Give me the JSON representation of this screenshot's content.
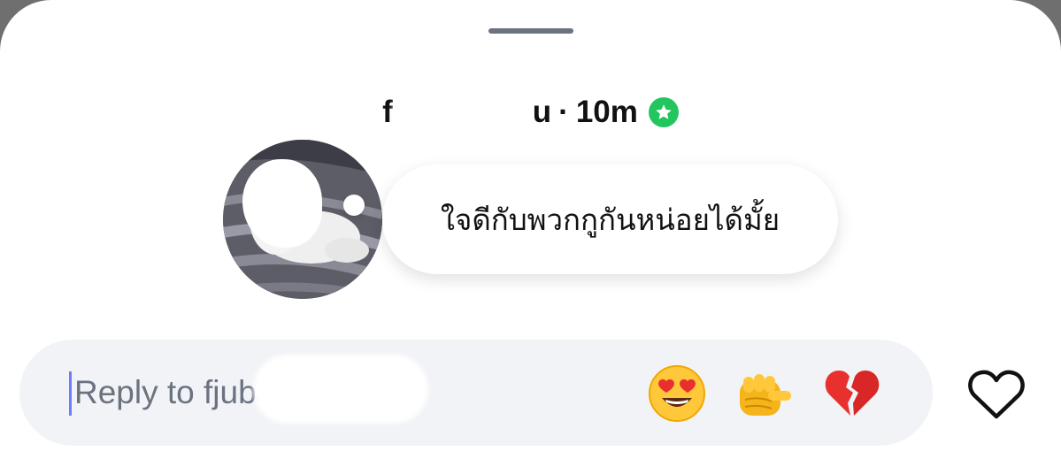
{
  "note": {
    "username_start": "f",
    "username_end": "u",
    "separator": "·",
    "age": "10m",
    "badge_icon": "star-badge-icon",
    "badge_color": "#22c55e",
    "text": "ใจดีกับพวกกูกันหน่อยได้มั้ย"
  },
  "reply": {
    "placeholder": "Reply to fjubaja",
    "caret_color": "#6b7cff"
  },
  "reactions": [
    {
      "name": "heart-eyes-emoji",
      "emoji": "😍"
    },
    {
      "name": "pointing-fist-emoji",
      "emoji": "👊"
    },
    {
      "name": "broken-heart-emoji",
      "emoji": "💔"
    }
  ],
  "like_icon": "heart-outline-icon"
}
